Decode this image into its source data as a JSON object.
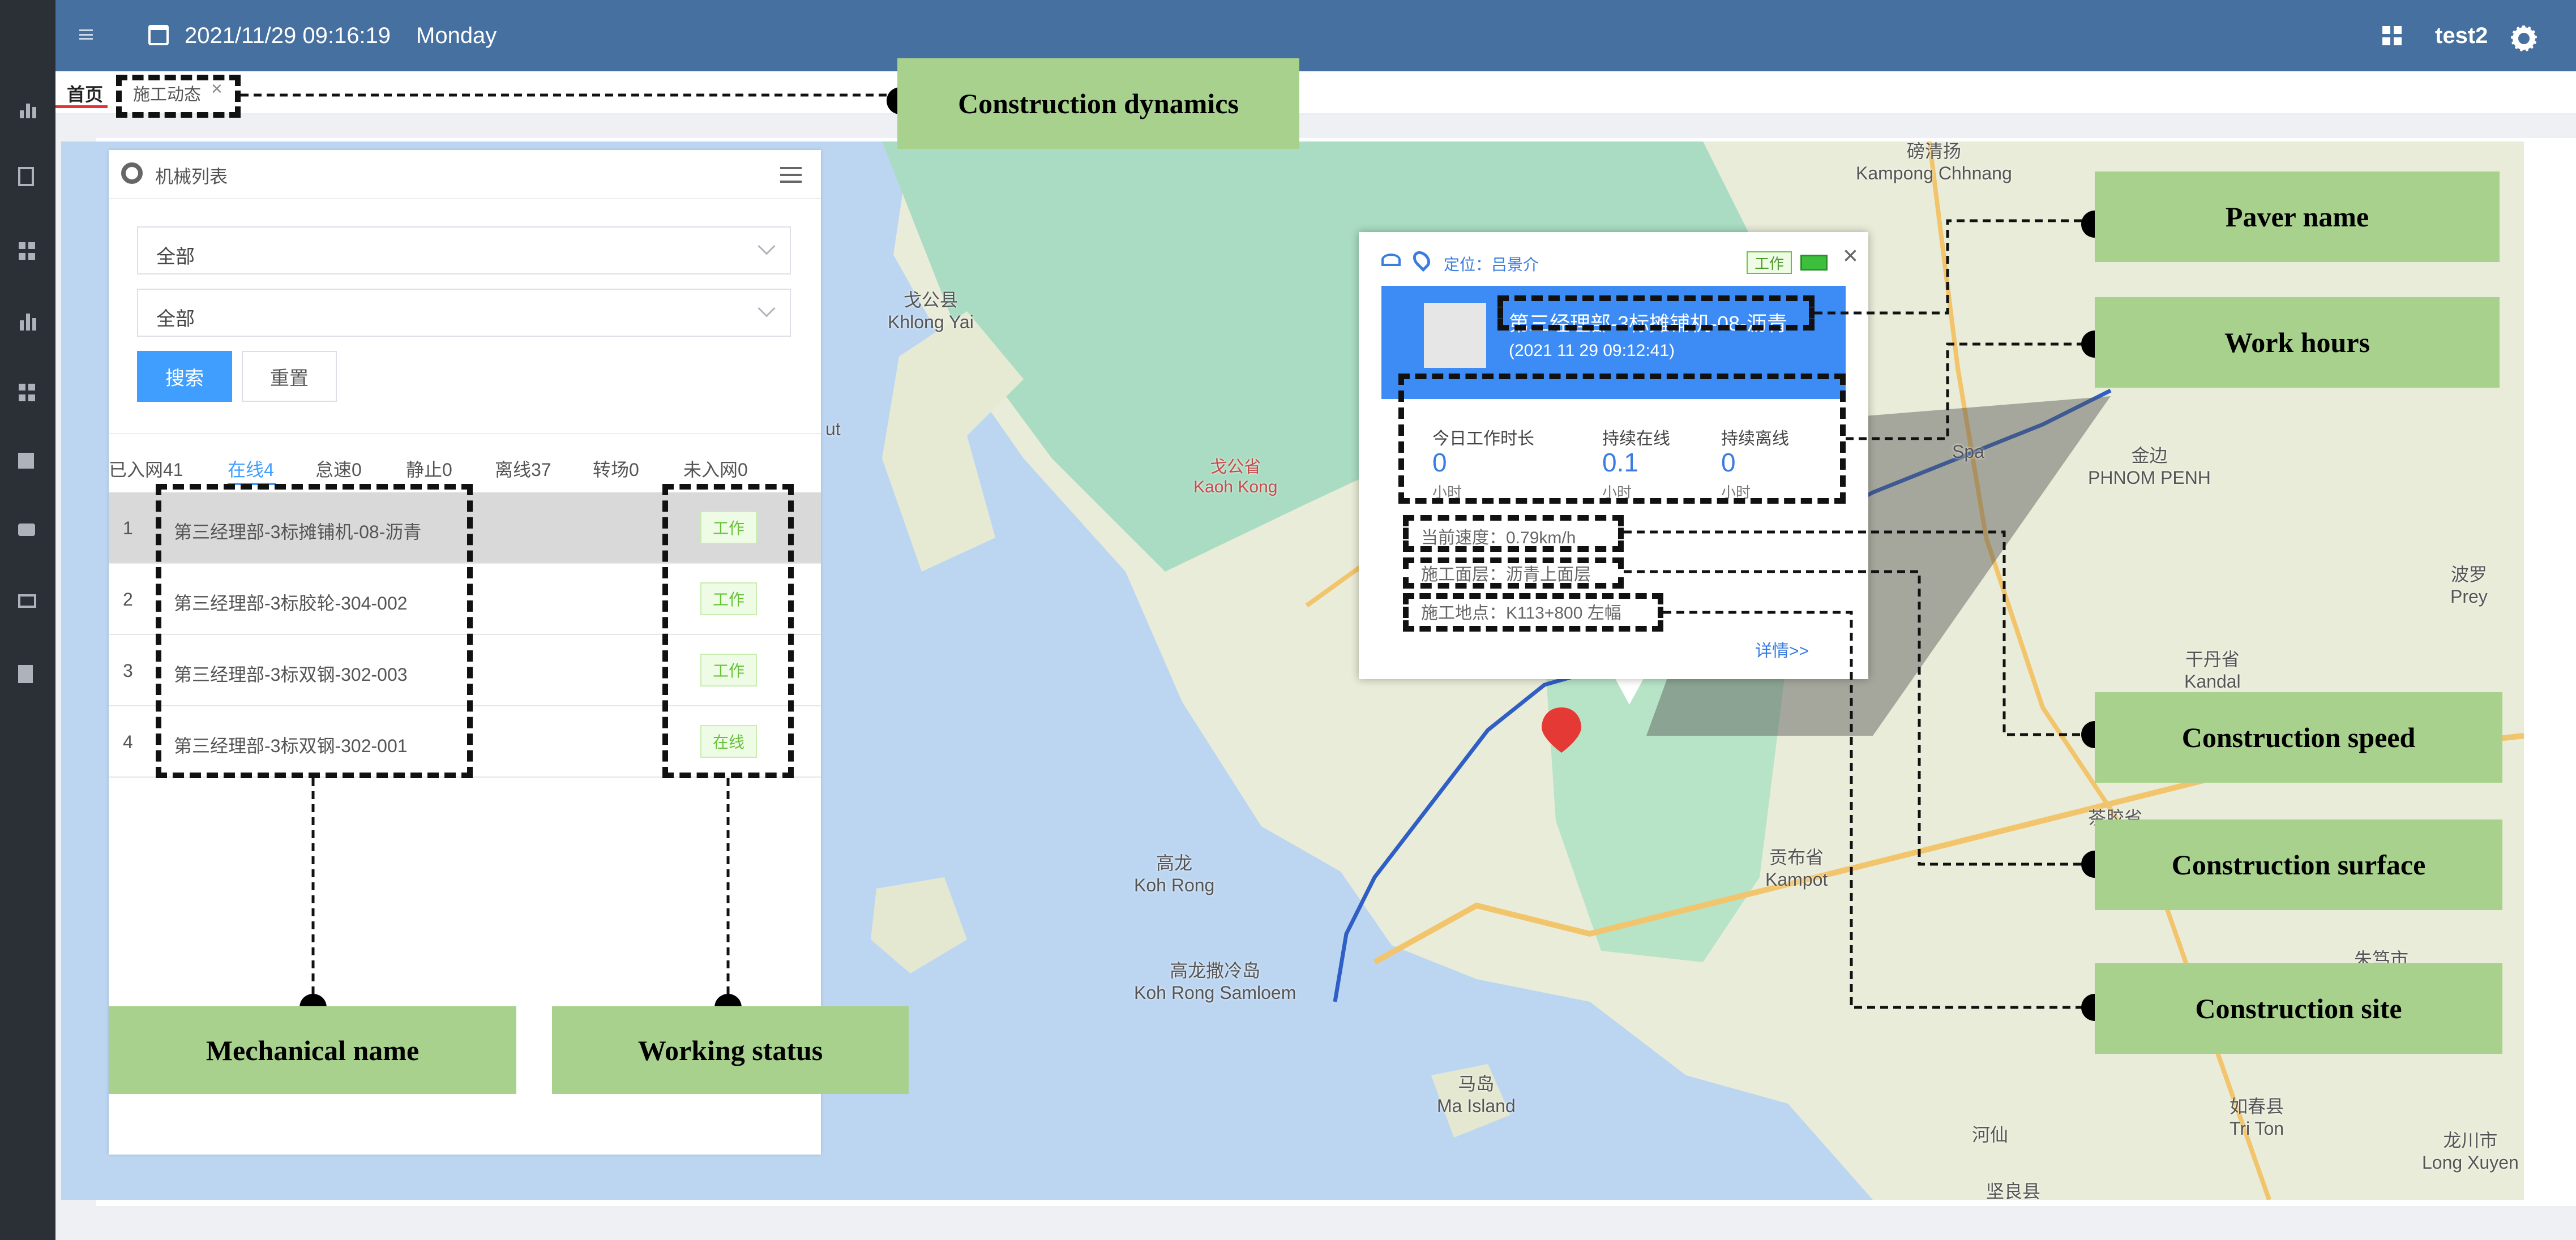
{
  "header": {
    "datetime": "2021/11/29  09:16:19",
    "weekday": "Monday",
    "user": "test2"
  },
  "tabs": [
    {
      "label": "首页",
      "active": true
    },
    {
      "label": "施工动态",
      "closable": true
    }
  ],
  "panel": {
    "title": "机械列表",
    "filter1": "全部",
    "filter2": "全部",
    "search_label": "搜索",
    "reset_label": "重置",
    "stats": [
      "已入网41",
      "在线4",
      "怠速0",
      "静止0",
      "离线37",
      "转场0",
      "未入网0"
    ],
    "rows": [
      {
        "index": "1",
        "name": "第三经理部-3标摊铺机-08-沥青",
        "status": "工作"
      },
      {
        "index": "2",
        "name": "第三经理部-3标胶轮-304-002",
        "status": "工作"
      },
      {
        "index": "3",
        "name": "第三经理部-3标双钢-302-003",
        "status": "工作"
      },
      {
        "index": "4",
        "name": "第三经理部-3标双钢-302-001",
        "status": "在线"
      }
    ]
  },
  "popup": {
    "locate_label": "定位：吕景介",
    "status": "工作",
    "paver_name": "第三经理部-3标摊铺机-08-沥青",
    "time": "(2021 11 29 09:12:41)",
    "work_today_label": "今日工作时长",
    "work_today_value": "0",
    "online_label": "持续在线",
    "online_value": "0.1",
    "offline_label": "持续离线",
    "offline_value": "0",
    "unit": "小时",
    "speed_text": "当前速度：0.79km/h",
    "surface_text": "施工面层：沥青上面层",
    "site_text": "施工地点：K113+800 左幅",
    "detail_link": "详情>>"
  },
  "map_labels": [
    {
      "text": "磅清扬\nKampong Chhnang"
    },
    {
      "text": "戈公县\nKhlong Yai"
    },
    {
      "text": "戈公省\nKaoh Kong",
      "style": "red"
    },
    {
      "text": "金边\nPHNOM PENH"
    },
    {
      "text": "波罗\nPrey"
    },
    {
      "text": "干丹省\nKandal"
    },
    {
      "text": "贡布省\nKampot"
    },
    {
      "text": "茶胶省"
    },
    {
      "text": "高龙\nKoh Rong"
    },
    {
      "text": "高龙撒冷岛\nKoh Rong Samloem"
    },
    {
      "text": "马岛\nMa Island"
    },
    {
      "text": "如春县\nTri Ton"
    },
    {
      "text": "龙川市\nLong Xuyen"
    },
    {
      "text": "河仙"
    },
    {
      "text": "坚良县"
    },
    {
      "text": "朱笃市"
    },
    {
      "text": "Spa"
    },
    {
      "text": "ut"
    }
  ],
  "callouts": {
    "construction_dynamics": "Construction dynamics",
    "paver_name": "Paver name",
    "work_hours": "Work hours",
    "construction_speed": "Construction speed",
    "construction_surface": "Construction surface",
    "construction_site": "Construction site",
    "mechanical_name": "Mechanical name",
    "working_status": "Working status"
  },
  "colors": {
    "topbar": "#45709f",
    "sidebar": "#2b2f36",
    "primary": "#409eff",
    "popup_header": "#3d8cf5",
    "callout": "#a9d18e",
    "route": "#2f5fc4",
    "marker": "#e53935",
    "status_green": "#67c23a"
  }
}
